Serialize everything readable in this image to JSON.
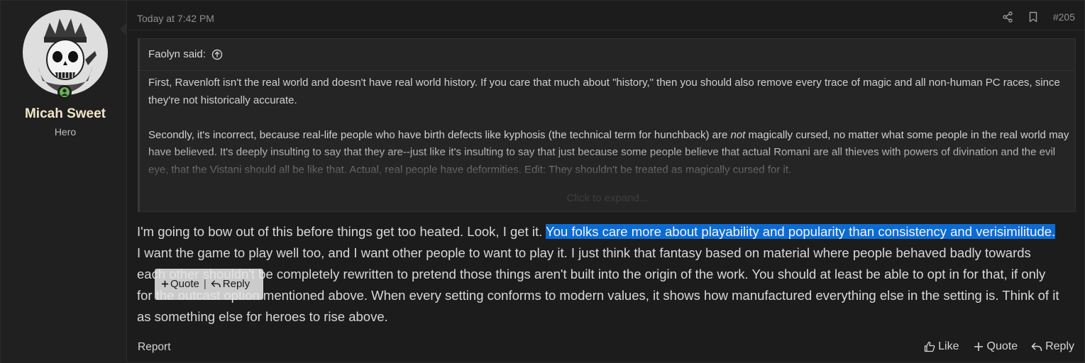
{
  "user": {
    "name": "Micah Sweet",
    "title": "Hero",
    "avatar_icon": "skull-avatar-icon",
    "online_color": "#63b64f"
  },
  "post": {
    "date": "Today at 7:42 PM",
    "number": "#205",
    "share_icon": "share-icon",
    "bookmark_icon": "bookmark-icon"
  },
  "quote": {
    "author": "Faolyn said:",
    "paragraph1": "First, Ravenloft isn't the real world and doesn't have real world history. If you care that much about \"history,\" then you should also remove every trace of magic and all non-human PC races, since they're not historically accurate.",
    "p2_before": "Secondly, it's incorrect, because real-life people who have birth defects like kyphosis (the technical term for hunchback) are ",
    "p2_em": "not",
    "p2_after": " magically cursed, no matter what some people in the real world may have believed. It's deeply insulting to say that they are--just like it's insulting to say that just because some people believe that actual Romani are all thieves with powers of divination and the evil eye, that the Vistani should all be like that. Actual, real people have deformities. Edit: They shouldn't be treated as magically cursed for it.",
    "expand_label": "Click to expand..."
  },
  "message": {
    "before": "I'm going to bow out of this before things get too heated. Look, I get it. ",
    "highlighted": "You folks care more about playability and popularity than consistency and verisimilitude.",
    "after": " I want the game to play well too, and I want other people to want to play it. I just think that fantasy based on material where people behaved badly towards each other shouldn't be completely rewritten to pretend those things aren't built into the origin of the work. You should at least be able to opt in for that, if only for the outcast option mentioned above. When every setting conforms to modern values, it shows how manufactured everything else in the setting is. Think of it as something else for heroes to rise above.",
    "highlight_color": "#0b6bd3"
  },
  "selection_tooltip": {
    "quote_label": "Quote",
    "separator": "|",
    "reply_label": "Reply"
  },
  "footer": {
    "report_label": "Report",
    "like_label": "Like",
    "quote_label": "Quote",
    "reply_label": "Reply"
  }
}
